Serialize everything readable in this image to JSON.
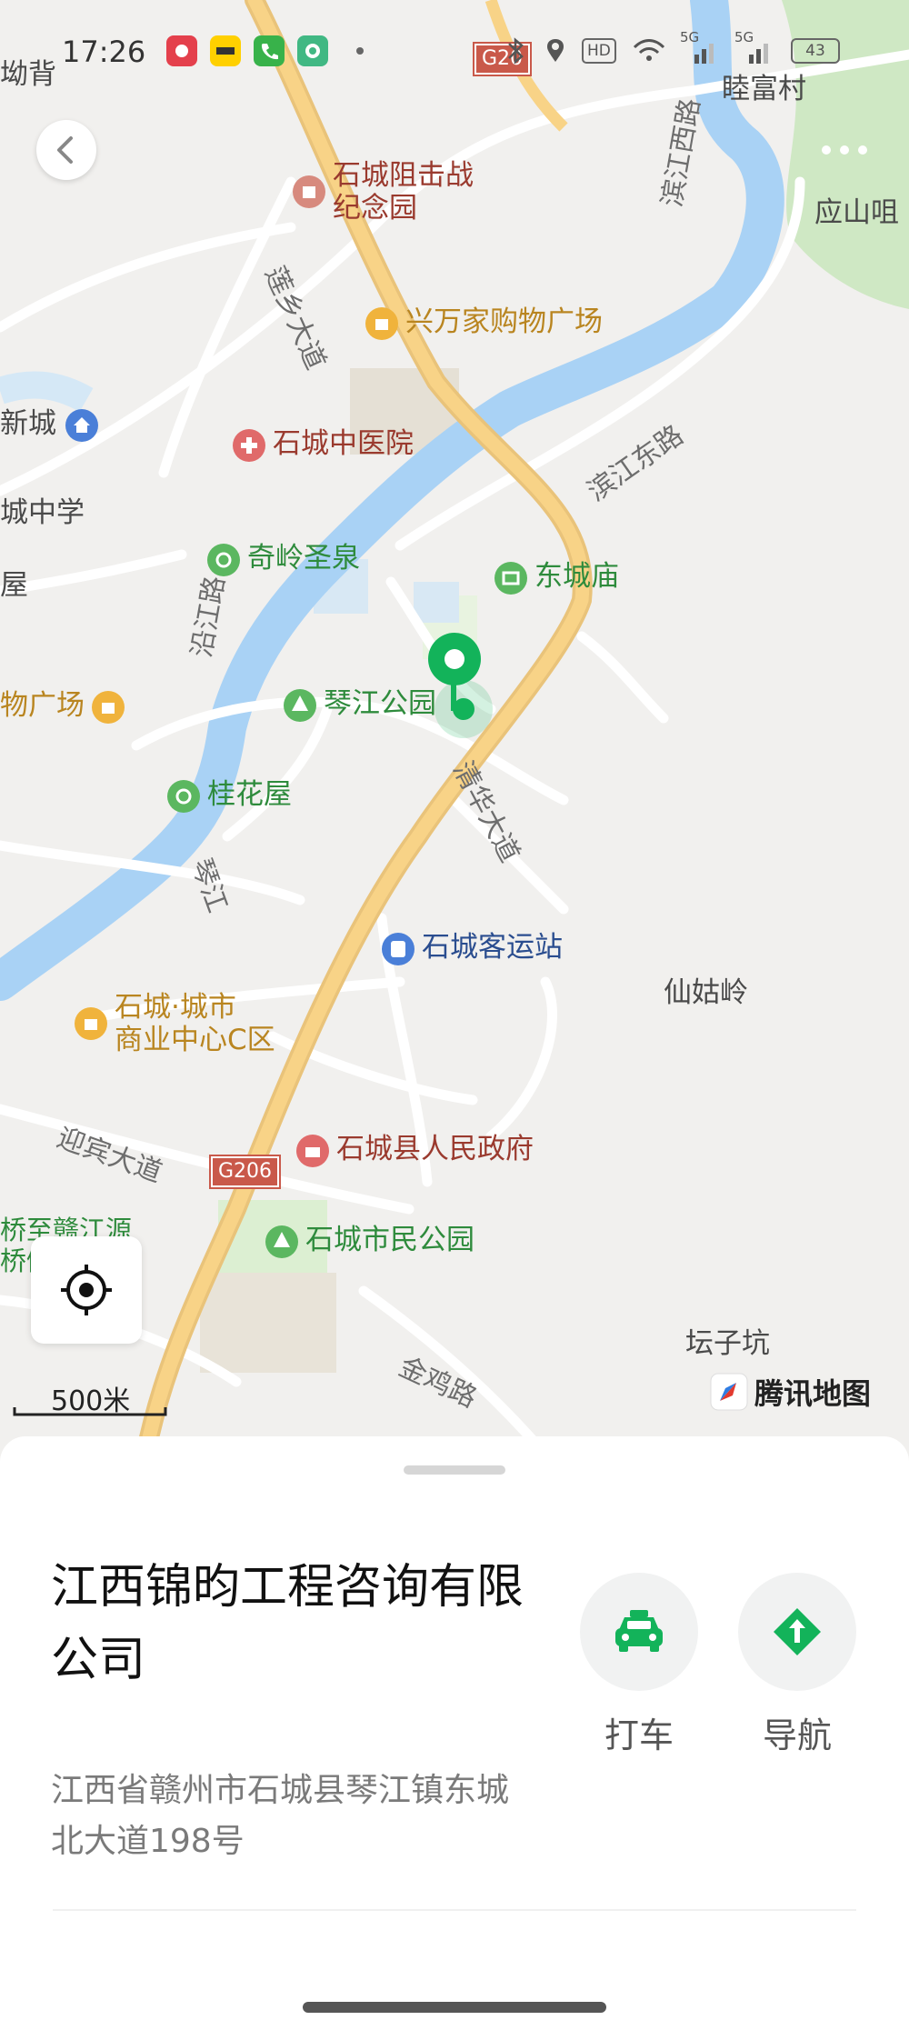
{
  "status_bar": {
    "time": "17:26",
    "battery": "43",
    "network_1": "5G",
    "network_2": "5G",
    "hd": "HD"
  },
  "map": {
    "labels": {
      "shicheng_battle": [
        "石城阻击战",
        "纪念园"
      ],
      "xingwan_mall": "兴万家购物广场",
      "tcm_hospital": "石城中医院",
      "qiling_spring": "奇岭圣泉",
      "dongcheng_temple": "东城庙",
      "qinjiang_park": "琴江公园",
      "guihua_house": "桂花屋",
      "bus_station": "石城客运站",
      "commerce_center": [
        "石城·城市",
        "商业中心C区"
      ],
      "county_gov": "石城县人民政府",
      "citizen_park": "石城市民公园",
      "xiangu_ridge": "仙姑岭",
      "tanzi_keng": "坛子坑",
      "mufu_village": "睦富村",
      "yingshan": "应山咀",
      "new_city": "新城",
      "middle_school": "城中学",
      "plaza_left": "物广场",
      "bridge_left": [
        "桥至赣江源",
        "桥侧"
      ],
      "edge_top_left": "坳背",
      "edge_left_1": "屋"
    },
    "roads": {
      "binjiang_west": "滨江西路",
      "binjiang_east": "滨江东路",
      "lianxiang": "莲乡大道",
      "yanjiang": "沿江路",
      "qingjiang": "琴江",
      "qinghua": "清华大道",
      "yingbin": "迎宾大道",
      "jinji": "金鸡路",
      "g206_a": "G206",
      "g206_b": "G20"
    },
    "scale": "500米",
    "brand": "腾讯地图"
  },
  "place": {
    "name": "江西锦昀工程咨询有限公司",
    "address": "江西省赣州市石城县琴江镇东城北大道198号"
  },
  "actions": {
    "taxi": "打车",
    "navigate": "导航"
  },
  "colors": {
    "accent": "#13b35a",
    "river": "#a9d2f5",
    "main_road": "#f8d387"
  }
}
